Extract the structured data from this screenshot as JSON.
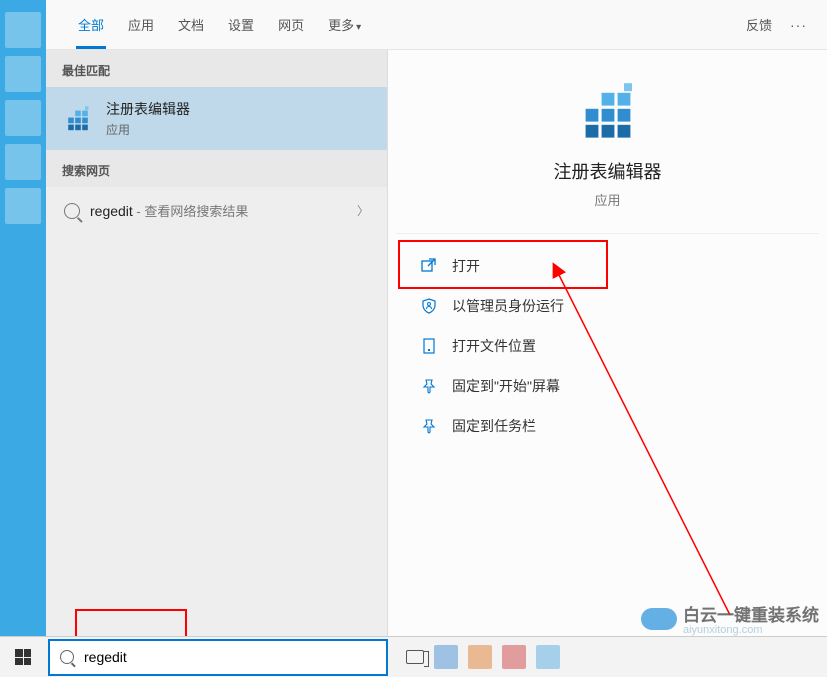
{
  "header": {
    "tabs": [
      "全部",
      "应用",
      "文档",
      "设置",
      "网页",
      "更多"
    ],
    "active_index": 0,
    "feedback": "反馈"
  },
  "sections": {
    "best_match": "最佳匹配",
    "web": "搜索网页"
  },
  "results": {
    "best": {
      "title": "注册表编辑器",
      "subtitle": "应用"
    },
    "web_item": {
      "query": "regedit",
      "hint": " - 查看网络搜索结果"
    }
  },
  "preview": {
    "name": "注册表编辑器",
    "type": "应用",
    "actions": [
      {
        "icon": "open-icon",
        "label": "打开"
      },
      {
        "icon": "admin-icon",
        "label": "以管理员身份运行"
      },
      {
        "icon": "folder-icon",
        "label": "打开文件位置"
      },
      {
        "icon": "pin-start-icon",
        "label": "固定到\"开始\"屏幕"
      },
      {
        "icon": "pin-taskbar-icon",
        "label": "固定到任务栏"
      }
    ]
  },
  "search": {
    "value": "regedit"
  },
  "watermark": {
    "text": "白云一键重装系统",
    "url": "aiyunxitong.com"
  },
  "colors": {
    "accent": "#0078d4",
    "highlight_border": "#ff0000"
  }
}
